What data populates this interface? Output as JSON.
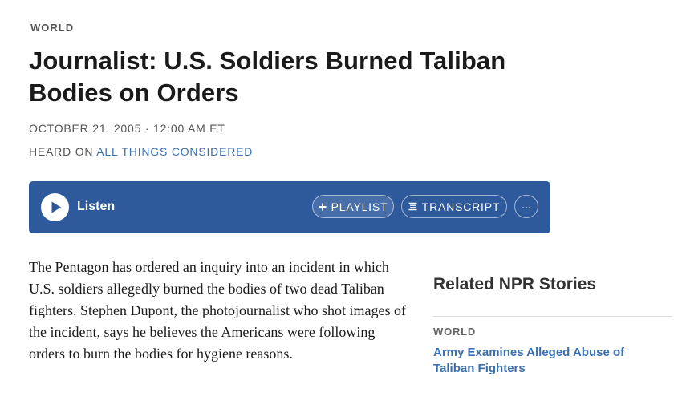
{
  "article": {
    "section": "WORLD",
    "headline": "Journalist: U.S. Soldiers Burned Taliban Bodies on Orders",
    "dateline": "OCTOBER 21, 2005 · 12:00 AM ET",
    "heard_on_prefix": "HEARD ON ",
    "heard_on_program": "ALL THINGS CONSIDERED",
    "body": "The Pentagon has ordered an inquiry into an incident in which U.S. soldiers allegedly burned the bodies of two dead Taliban fighters. Stephen Dupont, the photojournalist who shot images of the incident, says he believes the Americans were following orders to burn the bodies for hygiene reasons."
  },
  "player": {
    "listen_label": "Listen",
    "playlist_label": "PLAYLIST",
    "transcript_label": "TRANSCRIPT",
    "more_label": "···",
    "play_icon": "play-icon",
    "playlist_icon": "plus-icon",
    "transcript_icon": "list-icon",
    "accent_color": "#2e5a9c"
  },
  "related": {
    "title": "Related NPR Stories",
    "items": [
      {
        "section": "WORLD",
        "headline": "Army Examines Alleged Abuse of Taliban Fighters"
      }
    ]
  },
  "colors": {
    "link": "#3a6fb0",
    "meta_text": "#555555"
  }
}
